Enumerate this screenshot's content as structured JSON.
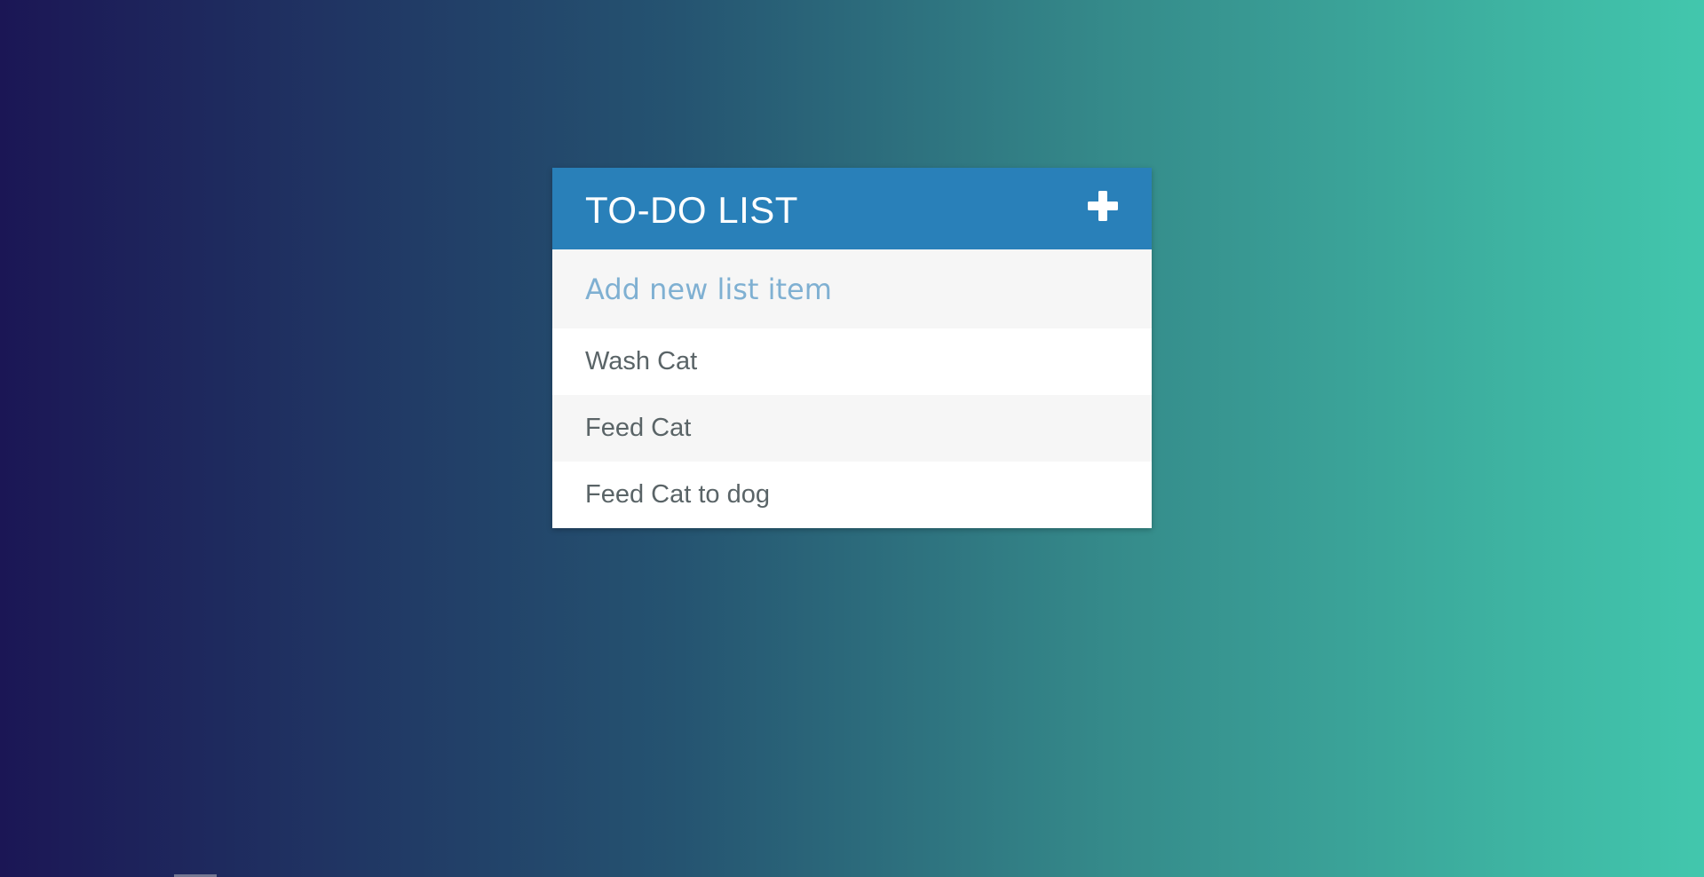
{
  "header": {
    "title": "TO-DO LIST",
    "add_icon": "plus-icon"
  },
  "new_item": {
    "placeholder": "Add new list item",
    "value": ""
  },
  "todos": [
    {
      "text": "Wash Cat"
    },
    {
      "text": "Feed Cat"
    },
    {
      "text": "Feed Cat to dog"
    }
  ],
  "colors": {
    "header_bg": "#2980b9",
    "placeholder": "#7fb0d2",
    "item_text": "#5a6467",
    "gradient_start": "#1b1655",
    "gradient_end": "#42c7ad"
  }
}
